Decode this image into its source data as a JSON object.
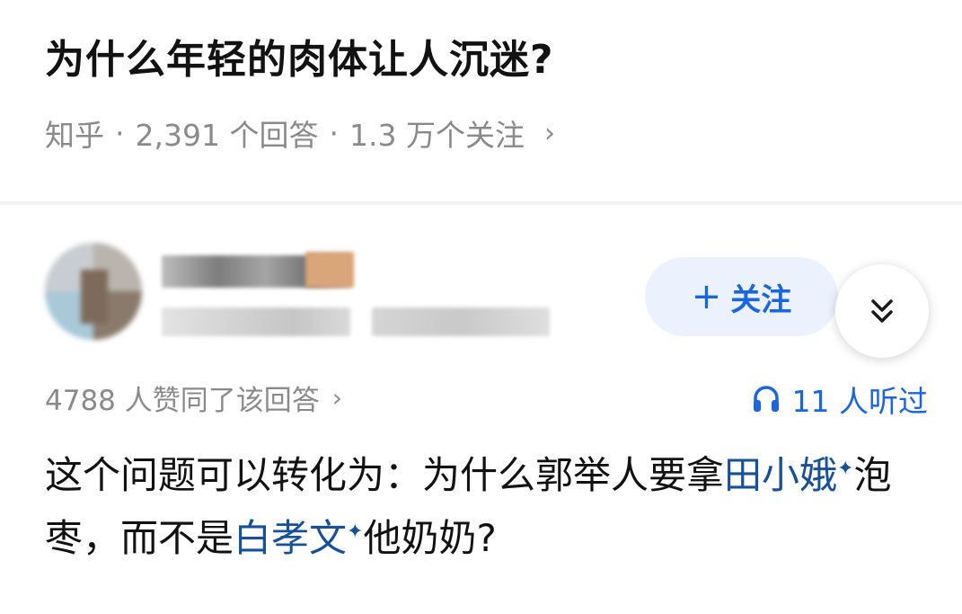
{
  "question": {
    "title": "为什么年轻的肉体让人沉迷?",
    "source": "知乎",
    "separator": "·",
    "answers_count": "2,391 个回答",
    "followers": "1.3 万个关注",
    "chevron": "›"
  },
  "author": {
    "avatar_icon": "avatar-blurred",
    "follow_plus": "+",
    "follow_label": "关注",
    "expand_icon": "double-chevron-down-icon"
  },
  "stats": {
    "upvotes": "4788 人赞同了该回答",
    "chevron": "›",
    "listen_icon": "headphones-icon",
    "listeners": "11 人听过"
  },
  "answer": {
    "part1": "这个问题可以转化为：为什么郭举人要拿",
    "link1": "田小娥",
    "spark": "✦",
    "part2": "泡枣，而不是",
    "link2": "白孝文",
    "part3": "他奶奶?"
  },
  "colors": {
    "accent": "#1a66e0",
    "link": "#175199",
    "muted": "#8a8a8a",
    "follow_bg": "#ebf2fd"
  }
}
